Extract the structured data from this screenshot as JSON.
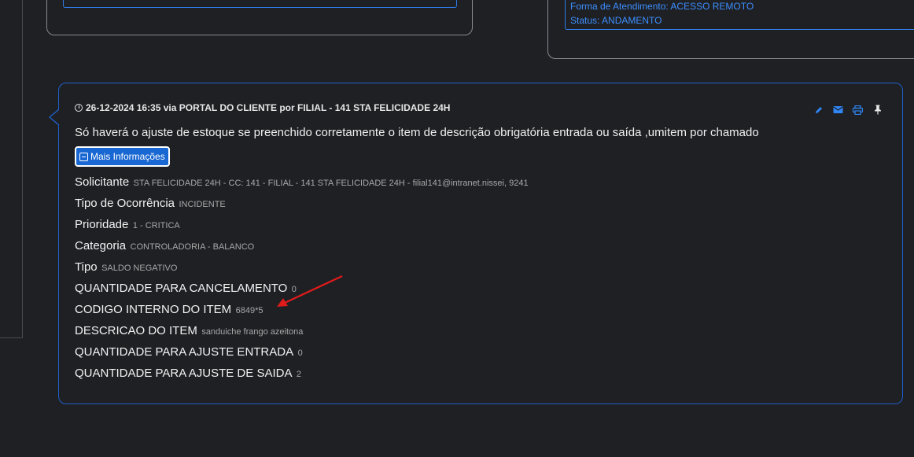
{
  "top_right": {
    "forma_line": "Forma de Atendimento: ACESSO REMOTO",
    "status_line": "Status: ANDAMENTO"
  },
  "ticket": {
    "meta": "26-12-2024 16:35 via PORTAL DO CLIENTE por FILIAL - 141 STA FELICIDADE 24H",
    "description": "Só haverá o ajuste de estoque se preenchido corretamente o item de descrição obrigatória entrada ou saída ,umitem por chamado",
    "more_button": "Mais Informações",
    "actions": [
      "pencil-icon",
      "envelope-icon",
      "print-icon",
      "pin-icon"
    ],
    "fields": [
      {
        "label": "Solicitante",
        "value": "STA FELICIDADE 24H - CC: 141 - FILIAL - 141 STA FELICIDADE 24H - filial141@intranet.nissei, 9241"
      },
      {
        "label": "Tipo de Ocorrência",
        "value": "INCIDENTE"
      },
      {
        "label": "Prioridade",
        "value": "1 - CRITICA"
      },
      {
        "label": "Categoria",
        "value": "CONTROLADORIA - BALANCO"
      },
      {
        "label": "Tipo",
        "value": "SALDO NEGATIVO"
      },
      {
        "label": "QUANTIDADE PARA CANCELAMENTO",
        "value": "0"
      },
      {
        "label": "CODIGO INTERNO DO ITEM",
        "value": "6849*5"
      },
      {
        "label": "DESCRICAO DO ITEM",
        "value": "sanduiche frango azeitona"
      },
      {
        "label": "QUANTIDADE PARA AJUSTE ENTRADA",
        "value": "0"
      },
      {
        "label": "QUANTIDADE PARA AJUSTE DE SAIDA",
        "value": "2"
      }
    ]
  },
  "colors": {
    "background": "#1f2024",
    "accent": "#1f5fc9",
    "link": "#3b8fff",
    "annotation_arrow": "#e01b1b"
  }
}
